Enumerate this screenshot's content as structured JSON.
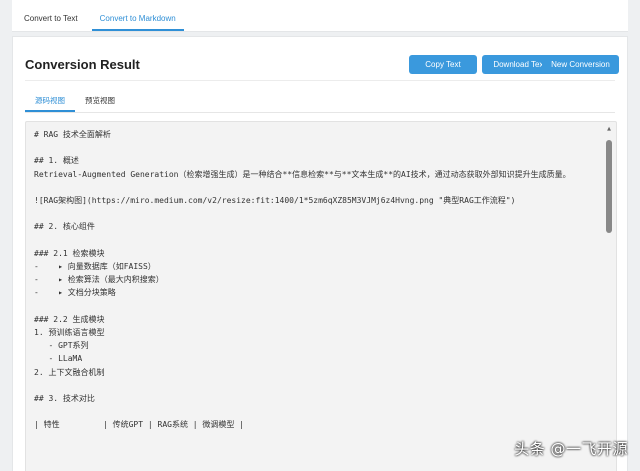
{
  "top_tabs": [
    {
      "label": "Convert to Text",
      "active": false
    },
    {
      "label": "Convert to Markdown",
      "active": true
    }
  ],
  "header": {
    "title": "Conversion Result",
    "copy_label": "Copy Text",
    "download_label": "Download Text",
    "new_label": "New Conversion"
  },
  "view_tabs": [
    {
      "label": "源码视图",
      "active": true
    },
    {
      "label": "预览视图",
      "active": false
    }
  ],
  "code_lines": [
    "# RAG 技术全面解析",
    "",
    "## 1. 概述",
    "Retrieval-Augmented Generation（检索增强生成）是一种结合**信息检索**与**文本生成**的AI技术，通过动态获取外部知识提升生成质量。",
    "",
    "![RAG架构图](https://miro.medium.com/v2/resize:fit:1400/1*5zm6qXZ85M3VJMj6z4Hvng.png \"典型RAG工作流程\")",
    "",
    "## 2. 核心组件",
    "",
    "### 2.1 检索模块",
    "-    ▸ 向量数据库（如FAISS）",
    "-    ▸ 检索算法（最大内积搜索）",
    "-    ▸ 文档分块策略",
    "",
    "### 2.2 生成模块",
    "1. 预训练语言模型",
    "   - GPT系列",
    "   - LLaMA",
    "2. 上下文融合机制",
    "",
    "## 3. 技术对比",
    "",
    "| 特性         | 传统GPT | RAG系统 | 微调模型 |"
  ],
  "scroll": {
    "position": 0.0,
    "visible_fraction": 0.28
  },
  "watermark": "头条 @一飞开源",
  "colors": {
    "accent": "#3a99dd",
    "tab_active": "#2f8fd6"
  }
}
